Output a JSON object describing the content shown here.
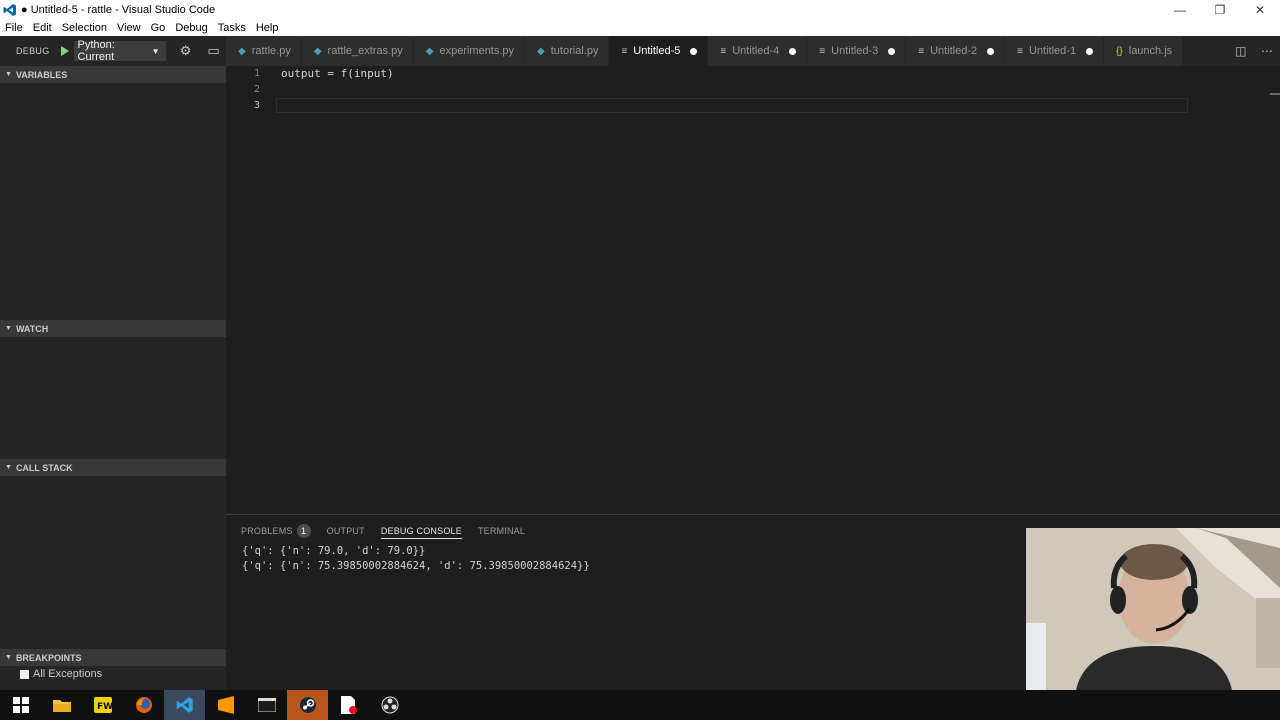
{
  "window": {
    "title": "● Untitled-5 - rattle - Visual Studio Code",
    "controls": [
      "minimize",
      "restore",
      "close"
    ]
  },
  "menu": [
    "File",
    "Edit",
    "Selection",
    "View",
    "Go",
    "Debug",
    "Tasks",
    "Help"
  ],
  "debug_toolbar": {
    "label": "DEBUG",
    "configuration": "Python: Current"
  },
  "tabs": [
    {
      "label": "rattle.py",
      "icon": "python-file-icon",
      "active": false,
      "dirty": false
    },
    {
      "label": "rattle_extras.py",
      "icon": "python-file-icon",
      "active": false,
      "dirty": false
    },
    {
      "label": "experiments.py",
      "icon": "python-file-icon",
      "active": false,
      "dirty": false
    },
    {
      "label": "tutorial.py",
      "icon": "python-file-icon",
      "active": false,
      "dirty": false
    },
    {
      "label": "Untitled-5",
      "icon": "document-icon",
      "active": true,
      "dirty": true
    },
    {
      "label": "Untitled-4",
      "icon": "document-icon",
      "active": false,
      "dirty": true
    },
    {
      "label": "Untitled-3",
      "icon": "document-icon",
      "active": false,
      "dirty": true
    },
    {
      "label": "Untitled-2",
      "icon": "document-icon",
      "active": false,
      "dirty": true
    },
    {
      "label": "Untitled-1",
      "icon": "document-icon",
      "active": false,
      "dirty": true
    },
    {
      "label": "launch.js",
      "icon": "json-file-icon",
      "active": false,
      "dirty": false
    }
  ],
  "sidebar": {
    "variables": "VARIABLES",
    "watch": "WATCH",
    "call_stack": "CALL STACK",
    "breakpoints": "BREAKPOINTS",
    "breakpoint_items": [
      "All Exceptions"
    ]
  },
  "editor": {
    "lines": [
      {
        "number": "1",
        "text": "output = f(input)"
      },
      {
        "number": "2",
        "text": ""
      },
      {
        "number": "3",
        "text": ""
      }
    ]
  },
  "panel": {
    "tabs": {
      "problems": "PROBLEMS",
      "problems_count": "1",
      "output": "OUTPUT",
      "debug_console": "DEBUG CONSOLE",
      "terminal": "TERMINAL"
    },
    "console_lines": [
      "{'q': {'n': 79.0, 'd': 79.0}}",
      "{'q': {'n': 75.39850002884624, 'd': 75.39850002884624}}"
    ]
  },
  "colors": {
    "editor_bg": "#1e1e1e",
    "sidebar_bg": "#252526",
    "section_header_bg": "#383838",
    "taskbar_bg": "#101010",
    "accent": "#007acc"
  }
}
